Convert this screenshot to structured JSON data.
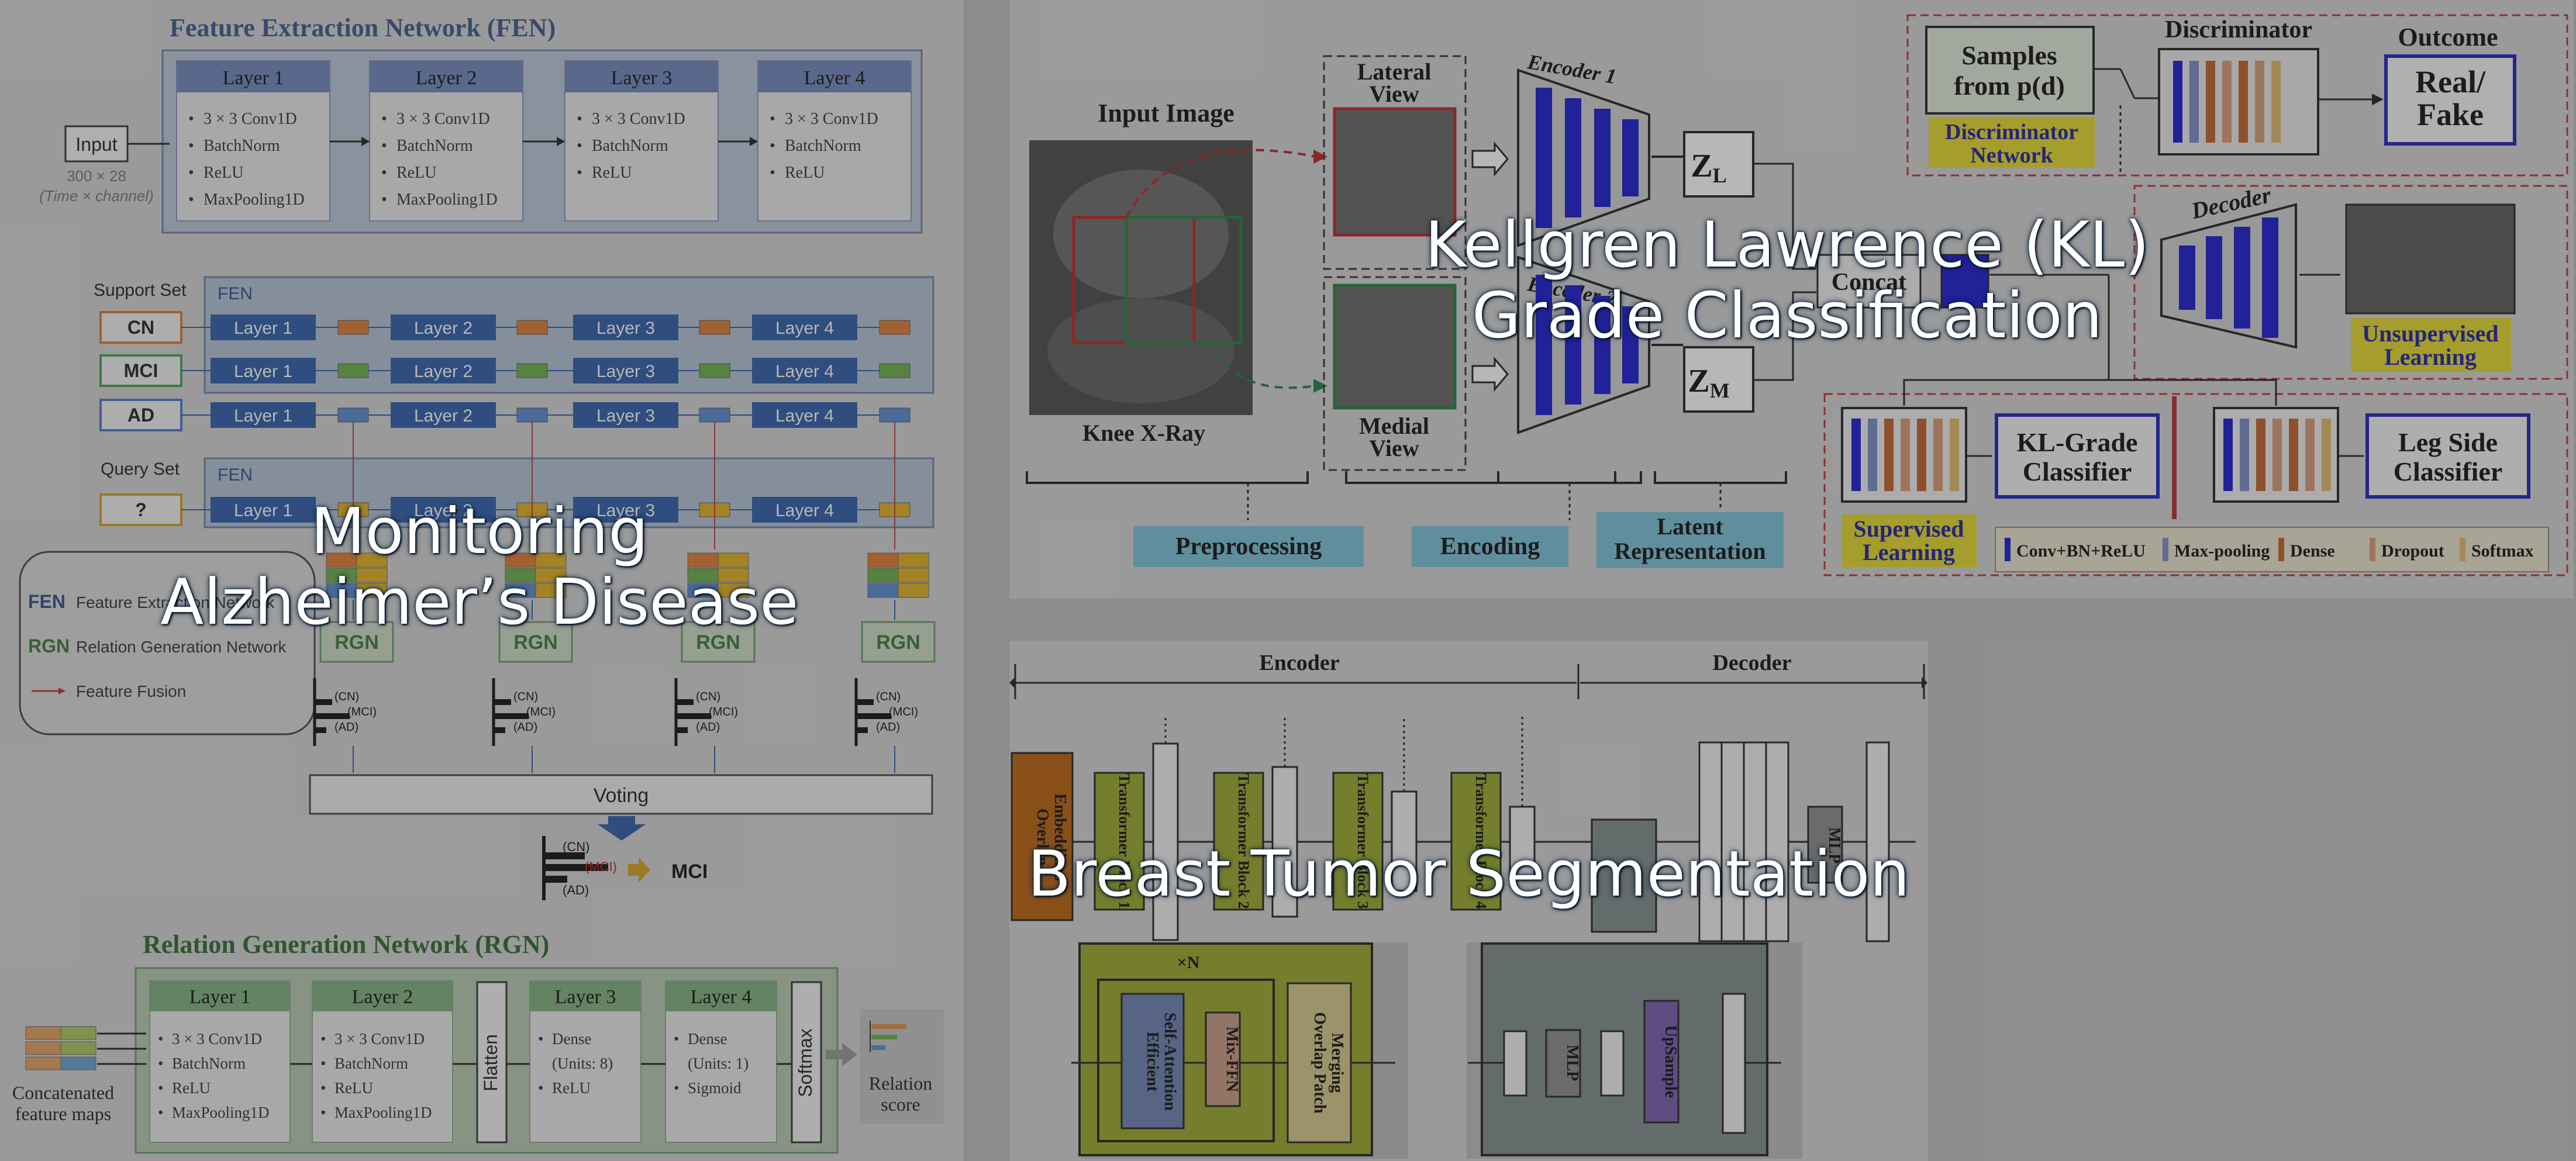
{
  "overlays": {
    "alzheimer": "Monitoring\nAlzheimer’s Disease",
    "kl": "Kellgren Lawrence (KL)\nGrade Classification",
    "breast": "Breast Tumor Segmentation"
  },
  "alz": {
    "fen_title": "Feature Extraction Network (FEN)",
    "input_label": "Input",
    "input_dims": "300 × 28",
    "input_caption": "(Time × channel)",
    "layers": [
      {
        "title": "Layer 1",
        "items": [
          "3 × 3 Conv1D",
          "BatchNorm",
          "ReLU",
          "MaxPooling1D"
        ]
      },
      {
        "title": "Layer 2",
        "items": [
          "3 × 3 Conv1D",
          "BatchNorm",
          "ReLU",
          "MaxPooling1D"
        ]
      },
      {
        "title": "Layer 3",
        "items": [
          "3 × 3 Conv1D",
          "BatchNorm",
          "ReLU"
        ]
      },
      {
        "title": "Layer 4",
        "items": [
          "3 × 3 Conv1D",
          "BatchNorm",
          "ReLU"
        ]
      }
    ],
    "support_set": "Support Set",
    "query_set": "Query Set",
    "fen_tag": "FEN",
    "classes": [
      "CN",
      "MCI",
      "AD"
    ],
    "query_mark": "?",
    "layer_names": [
      "Layer 1",
      "Layer 2",
      "Layer 3",
      "Layer 4"
    ],
    "legend": {
      "fen_abbr": "FEN",
      "fen_text": "Feature Extraction Network",
      "rgn_abbr": "RGN",
      "rgn_text": "Relation Generation Network",
      "fusion_text": "Feature Fusion"
    },
    "rgn_label": "RGN",
    "bar_labels": [
      "(CN)",
      "(MCI)",
      "(AD)"
    ],
    "voting": "Voting",
    "result": "MCI",
    "rgn_title": "Relation Generation Network (RGN)",
    "rgn_layers": [
      {
        "title": "Layer 1",
        "items": [
          "3 × 3 Conv1D",
          "BatchNorm",
          "ReLU",
          "MaxPooling1D"
        ]
      },
      {
        "title": "Layer 2",
        "items": [
          "3 × 3 Conv1D",
          "BatchNorm",
          "ReLU",
          "MaxPooling1D"
        ]
      },
      {
        "title": "Layer 3",
        "items": [
          "Dense",
          "(Units: 8)",
          "ReLU"
        ]
      },
      {
        "title": "Layer 4",
        "items": [
          "Dense",
          "(Units: 1)",
          "Sigmoid"
        ]
      }
    ],
    "flatten": "Flatten",
    "softmax": "Softmax",
    "concat_caption": [
      "Concatenated",
      "feature maps"
    ],
    "relation_score": [
      "Relation",
      "score"
    ]
  },
  "kl": {
    "input_image": "Input Image",
    "knee": "Knee X-Ray",
    "lateral": [
      "Lateral",
      "View"
    ],
    "medial": [
      "Medial",
      "View"
    ],
    "encoder1": "Encoder 1",
    "encoder2": "Encoder 2",
    "zl": "Z",
    "zl_sub": "L",
    "zm": "Z",
    "zm_sub": "M",
    "concat": "Concat",
    "samples": [
      "Samples",
      "from p(d)"
    ],
    "discriminator": "Discriminator",
    "outcome": "Outcome",
    "real_fake": [
      "Real/",
      "Fake"
    ],
    "disc_network": [
      "Discriminator",
      "Network"
    ],
    "decoder": "Decoder",
    "unsupervised": [
      "Unsupervised",
      "Learning"
    ],
    "kl_classifier": [
      "KL-Grade",
      "Classifier"
    ],
    "leg_classifier": [
      "Leg Side",
      "Classifier"
    ],
    "supervised": [
      "Supervised",
      "Learning"
    ],
    "preprocessing": "Preprocessing",
    "encoding": "Encoding",
    "latent": [
      "Latent",
      "Representation"
    ],
    "legend": [
      "Conv+BN+ReLU",
      "Max-pooling",
      "Dense",
      "Dropout",
      "Softmax"
    ],
    "colors": {
      "conv": "#1a1ad0",
      "pool": "#7a8cc8",
      "dense": "#c0622a",
      "dropout": "#d79a73",
      "softmax": "#e1b86a"
    }
  },
  "seg": {
    "encoder": "Encoder",
    "decoder": "Decoder",
    "overlap_embed": [
      "Overlap",
      "Embeddings"
    ],
    "transformer_blocks": [
      "Transformer Block 1",
      "Transformer Block 2",
      "Transformer Block 3",
      "Transformer Block 4"
    ],
    "mlp": "MLP",
    "xn": "×N",
    "efficient": [
      "Efficient",
      "Self-Attention"
    ],
    "mixffn": "Mix-FFN",
    "overlap_merge": [
      "Overlap Patch",
      "Merging"
    ],
    "upsample": "UpSample"
  }
}
